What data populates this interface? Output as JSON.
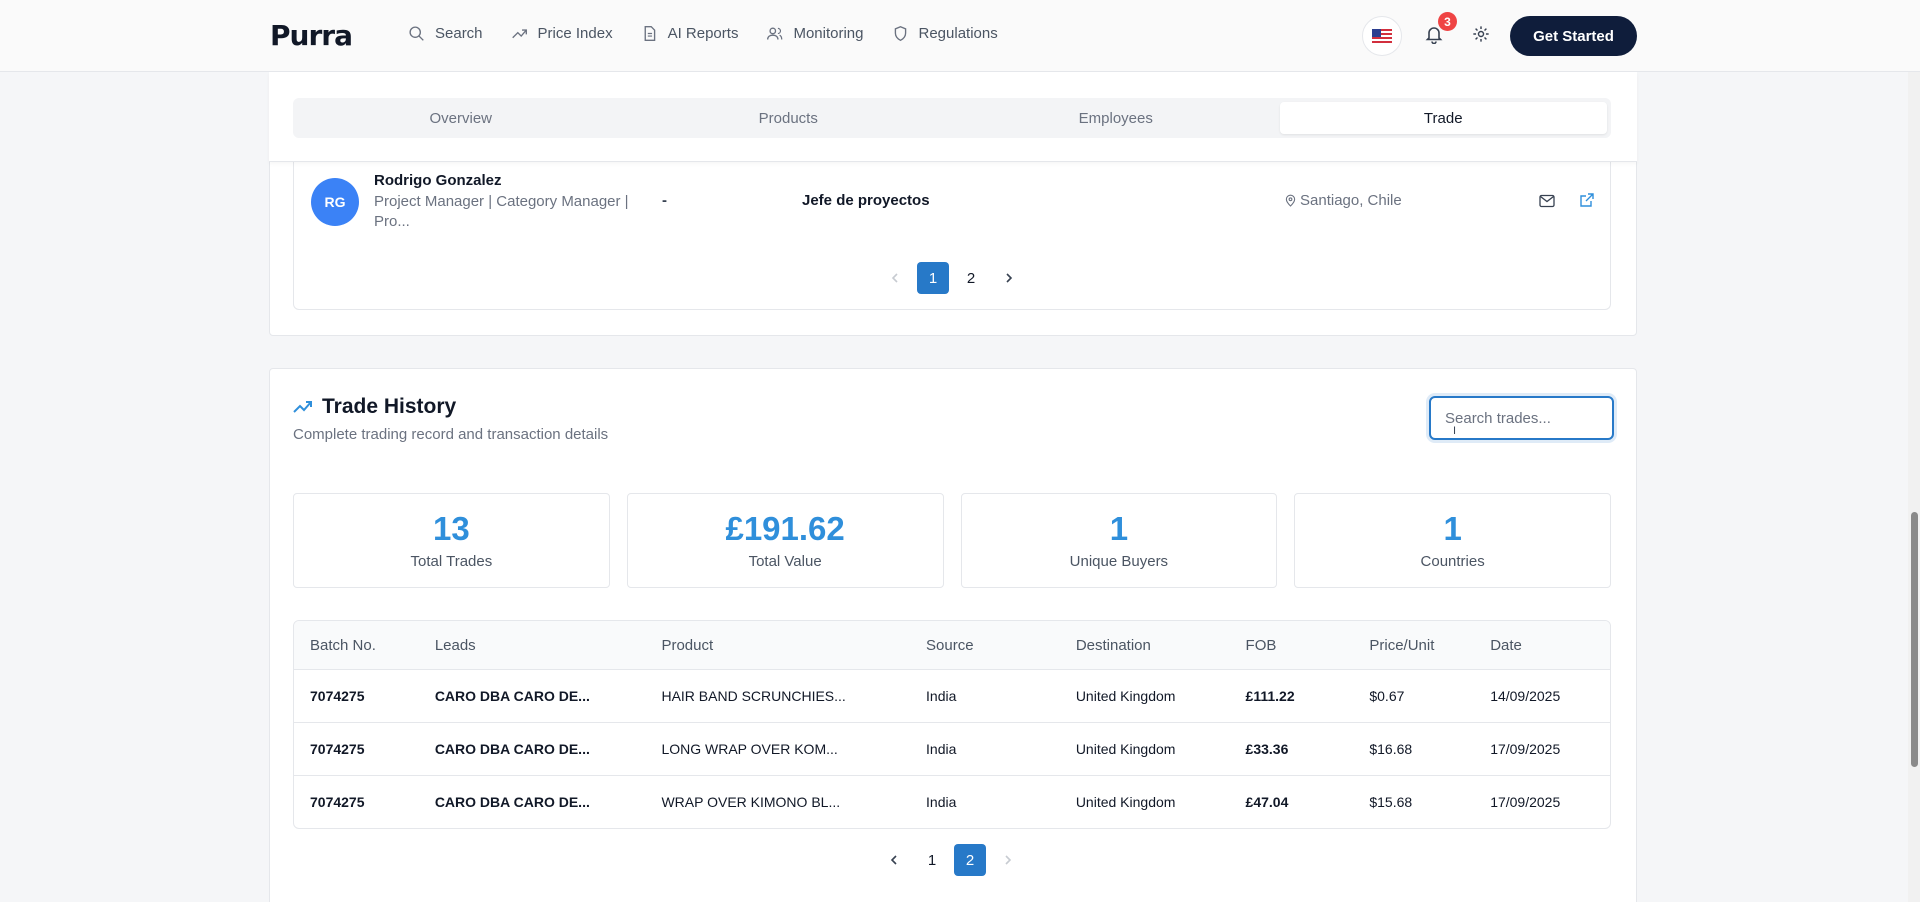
{
  "brand": {
    "logo": "Purra"
  },
  "nav": [
    {
      "label": "Search",
      "icon": "search-icon"
    },
    {
      "label": "Price Index",
      "icon": "trending-up-icon"
    },
    {
      "label": "AI Reports",
      "icon": "document-icon"
    },
    {
      "label": "Monitoring",
      "icon": "users-icon"
    },
    {
      "label": "Regulations",
      "icon": "shield-icon"
    }
  ],
  "header": {
    "notification_count": "3",
    "cta": "Get Started",
    "flag": "us-flag-icon"
  },
  "tabs": [
    {
      "label": "Overview",
      "active": false
    },
    {
      "label": "Products",
      "active": false
    },
    {
      "label": "Employees",
      "active": false
    },
    {
      "label": "Trade",
      "active": true
    }
  ],
  "employee": {
    "initials": "RG",
    "name": "Rodrigo Gonzalez",
    "title": "Project Manager | Category Manager | Pro...",
    "dash": "-",
    "role": "Jefe de proyectos",
    "location": "Santiago, Chile"
  },
  "employee_pager": {
    "pages": [
      "1",
      "2"
    ],
    "current": "1"
  },
  "trade_history": {
    "title": "Trade History",
    "subtitle": "Complete trading record and transaction details",
    "search_placeholder": "Search trades...",
    "stats": [
      {
        "value": "13",
        "label": "Total Trades"
      },
      {
        "value": "£191.62",
        "label": "Total Value"
      },
      {
        "value": "1",
        "label": "Unique Buyers"
      },
      {
        "value": "1",
        "label": "Countries"
      }
    ],
    "columns": [
      "Batch No.",
      "Leads",
      "Product",
      "Source",
      "Destination",
      "FOB",
      "Price/Unit",
      "Date"
    ],
    "rows": [
      [
        "7074275",
        "CARO DBA CARO DE...",
        "HAIR BAND SCRUNCHIES...",
        "India",
        "United Kingdom",
        "£111.22",
        "$0.67",
        "14/09/2025"
      ],
      [
        "7074275",
        "CARO DBA CARO DE...",
        "LONG WRAP OVER KOM...",
        "India",
        "United Kingdom",
        "£33.36",
        "$16.68",
        "17/09/2025"
      ],
      [
        "7074275",
        "CARO DBA CARO DE...",
        "WRAP OVER KIMONO BL...",
        "India",
        "United Kingdom",
        "£47.04",
        "$15.68",
        "17/09/2025"
      ]
    ],
    "pager": {
      "pages": [
        "1",
        "2"
      ],
      "current": "2"
    }
  },
  "colors": {
    "accent": "#2779c8",
    "stat": "#2f8fdb",
    "cta": "#0f1d3b",
    "badge": "#ef4444"
  }
}
